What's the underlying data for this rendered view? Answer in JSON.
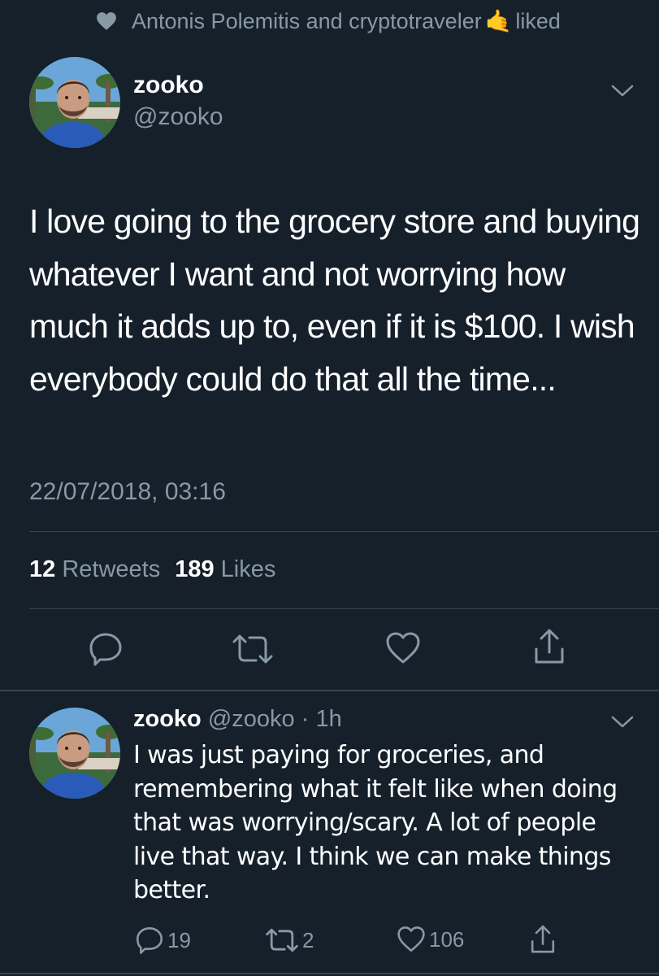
{
  "context": {
    "text_before": "Antonis Polemitis and cryptotraveler",
    "emoji": "🤙",
    "text_after": "liked",
    "icon": "heart-icon"
  },
  "tweet": {
    "name": "zooko",
    "handle": "@zooko",
    "text": "I love going to the grocery store and buying whatever I want and not worrying how much it adds up to, even if it is $100. I wish everybody could do that all the time...",
    "timestamp": "22/07/2018, 03:16",
    "retweets_count": "12",
    "retweets_label": "Retweets",
    "likes_count": "189",
    "likes_label": "Likes",
    "actions": [
      "reply-icon",
      "retweet-icon",
      "like-icon",
      "share-icon"
    ]
  },
  "reply": {
    "name": "zooko",
    "handle_time": "@zooko · 1h",
    "text": "I was just paying for groceries, and remembering what it felt like when doing that was worrying/scary. A lot of people live that way. I think we can make things better.",
    "reply_count": "19",
    "retweet_count": "2",
    "like_count": "106"
  },
  "colors": {
    "background": "#15202b",
    "muted": "#8899a6",
    "divider": "#38444d",
    "text": "#ffffff"
  }
}
